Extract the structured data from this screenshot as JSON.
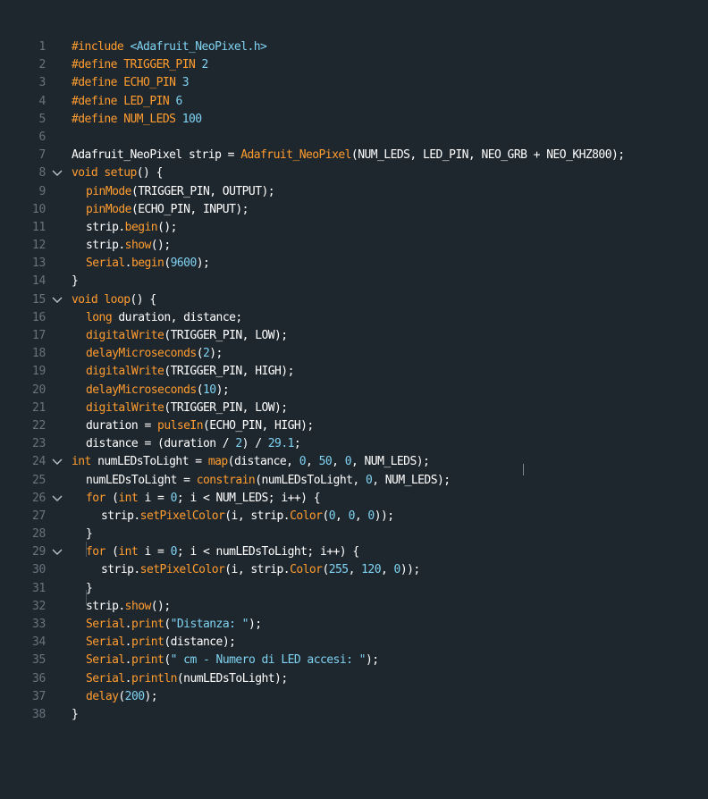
{
  "editor": {
    "colors": {
      "background": "#1f272e",
      "line_number": "#67737d",
      "keyword": "#ff9c2e",
      "number": "#7fd3f2",
      "text": "#ffffff"
    },
    "lines": [
      {
        "n": "1",
        "i": 0,
        "fold": false,
        "t": [
          {
            "c": "k",
            "v": "#include "
          },
          {
            "c": "s",
            "v": "<Adafruit_NeoPixel.h>"
          }
        ]
      },
      {
        "n": "2",
        "i": 0,
        "fold": false,
        "t": [
          {
            "c": "k",
            "v": "#define TRIGGER_PIN "
          },
          {
            "c": "num",
            "v": "2"
          }
        ]
      },
      {
        "n": "3",
        "i": 0,
        "fold": false,
        "t": [
          {
            "c": "k",
            "v": "#define ECHO_PIN "
          },
          {
            "c": "num",
            "v": "3"
          }
        ]
      },
      {
        "n": "4",
        "i": 0,
        "fold": false,
        "t": [
          {
            "c": "k",
            "v": "#define LED_PIN "
          },
          {
            "c": "num",
            "v": "6"
          }
        ]
      },
      {
        "n": "5",
        "i": 0,
        "fold": false,
        "t": [
          {
            "c": "k",
            "v": "#define NUM_LEDS "
          },
          {
            "c": "num",
            "v": "100"
          }
        ]
      },
      {
        "n": "6",
        "i": 0,
        "fold": false,
        "t": []
      },
      {
        "n": "7",
        "i": 0,
        "fold": false,
        "t": [
          {
            "c": "n",
            "v": "Adafruit_NeoPixel strip = "
          },
          {
            "c": "f",
            "v": "Adafruit_NeoPixel"
          },
          {
            "c": "n",
            "v": "(NUM_LEDS, LED_PIN, NEO_GRB + NEO_KHZ800);"
          }
        ]
      },
      {
        "n": "8",
        "i": 0,
        "fold": true,
        "t": [
          {
            "c": "k",
            "v": "void "
          },
          {
            "c": "f",
            "v": "setup"
          },
          {
            "c": "n",
            "v": "() {"
          }
        ]
      },
      {
        "n": "9",
        "i": 1,
        "fold": false,
        "t": [
          {
            "c": "f",
            "v": "pinMode"
          },
          {
            "c": "n",
            "v": "(TRIGGER_PIN, OUTPUT);"
          }
        ]
      },
      {
        "n": "10",
        "i": 1,
        "fold": false,
        "t": [
          {
            "c": "f",
            "v": "pinMode"
          },
          {
            "c": "n",
            "v": "(ECHO_PIN, INPUT);"
          }
        ]
      },
      {
        "n": "11",
        "i": 1,
        "fold": false,
        "t": [
          {
            "c": "n",
            "v": "strip."
          },
          {
            "c": "f",
            "v": "begin"
          },
          {
            "c": "n",
            "v": "();"
          }
        ]
      },
      {
        "n": "12",
        "i": 1,
        "fold": false,
        "t": [
          {
            "c": "n",
            "v": "strip."
          },
          {
            "c": "f",
            "v": "show"
          },
          {
            "c": "n",
            "v": "();"
          }
        ]
      },
      {
        "n": "13",
        "i": 1,
        "fold": false,
        "t": [
          {
            "c": "f",
            "v": "Serial"
          },
          {
            "c": "n",
            "v": "."
          },
          {
            "c": "f",
            "v": "begin"
          },
          {
            "c": "n",
            "v": "("
          },
          {
            "c": "num",
            "v": "9600"
          },
          {
            "c": "n",
            "v": ");"
          }
        ]
      },
      {
        "n": "14",
        "i": 0,
        "fold": false,
        "t": [
          {
            "c": "n",
            "v": "}"
          }
        ]
      },
      {
        "n": "15",
        "i": 0,
        "fold": true,
        "t": [
          {
            "c": "k",
            "v": "void "
          },
          {
            "c": "f",
            "v": "loop"
          },
          {
            "c": "n",
            "v": "() {"
          }
        ]
      },
      {
        "n": "16",
        "i": 1,
        "fold": false,
        "t": [
          {
            "c": "k",
            "v": "long "
          },
          {
            "c": "n",
            "v": "duration, distance;"
          }
        ]
      },
      {
        "n": "17",
        "i": 1,
        "fold": false,
        "t": [
          {
            "c": "f",
            "v": "digitalWrite"
          },
          {
            "c": "n",
            "v": "(TRIGGER_PIN, LOW);"
          }
        ]
      },
      {
        "n": "18",
        "i": 1,
        "fold": false,
        "t": [
          {
            "c": "f",
            "v": "delayMicroseconds"
          },
          {
            "c": "n",
            "v": "("
          },
          {
            "c": "num",
            "v": "2"
          },
          {
            "c": "n",
            "v": ");"
          }
        ]
      },
      {
        "n": "19",
        "i": 1,
        "fold": false,
        "t": [
          {
            "c": "f",
            "v": "digitalWrite"
          },
          {
            "c": "n",
            "v": "(TRIGGER_PIN, HIGH);"
          }
        ]
      },
      {
        "n": "20",
        "i": 1,
        "fold": false,
        "t": [
          {
            "c": "f",
            "v": "delayMicroseconds"
          },
          {
            "c": "n",
            "v": "("
          },
          {
            "c": "num",
            "v": "10"
          },
          {
            "c": "n",
            "v": ");"
          }
        ]
      },
      {
        "n": "21",
        "i": 1,
        "fold": false,
        "t": [
          {
            "c": "f",
            "v": "digitalWrite"
          },
          {
            "c": "n",
            "v": "(TRIGGER_PIN, LOW);"
          }
        ]
      },
      {
        "n": "22",
        "i": 1,
        "fold": false,
        "t": [
          {
            "c": "n",
            "v": "duration = "
          },
          {
            "c": "f",
            "v": "pulseIn"
          },
          {
            "c": "n",
            "v": "(ECHO_PIN, HIGH);"
          }
        ]
      },
      {
        "n": "23",
        "i": 1,
        "fold": false,
        "t": [
          {
            "c": "n",
            "v": "distance = (duration / "
          },
          {
            "c": "num",
            "v": "2"
          },
          {
            "c": "n",
            "v": ") / "
          },
          {
            "c": "num",
            "v": "29.1"
          },
          {
            "c": "n",
            "v": ";"
          }
        ]
      },
      {
        "n": "24",
        "i": 0,
        "fold": true,
        "t": [
          {
            "c": "k",
            "v": "int "
          },
          {
            "c": "n",
            "v": "numLEDsToLight = "
          },
          {
            "c": "f",
            "v": "map"
          },
          {
            "c": "n",
            "v": "(distance, "
          },
          {
            "c": "num",
            "v": "0"
          },
          {
            "c": "n",
            "v": ", "
          },
          {
            "c": "num",
            "v": "50"
          },
          {
            "c": "n",
            "v": ", "
          },
          {
            "c": "num",
            "v": "0"
          },
          {
            "c": "n",
            "v": ", NUM_LEDS);"
          }
        ]
      },
      {
        "n": "25",
        "i": 1,
        "fold": false,
        "t": [
          {
            "c": "n",
            "v": "numLEDsToLight = "
          },
          {
            "c": "f",
            "v": "constrain"
          },
          {
            "c": "n",
            "v": "(numLEDsToLight, "
          },
          {
            "c": "num",
            "v": "0"
          },
          {
            "c": "n",
            "v": ", NUM_LEDS);"
          }
        ]
      },
      {
        "n": "26",
        "i": 1,
        "fold": true,
        "t": [
          {
            "c": "k",
            "v": "for "
          },
          {
            "c": "n",
            "v": "("
          },
          {
            "c": "k",
            "v": "int "
          },
          {
            "c": "n",
            "v": "i = "
          },
          {
            "c": "num",
            "v": "0"
          },
          {
            "c": "n",
            "v": "; i < NUM_LEDS; i++) {"
          }
        ]
      },
      {
        "n": "27",
        "i": 2,
        "fold": false,
        "t": [
          {
            "c": "n",
            "v": "strip."
          },
          {
            "c": "f",
            "v": "setPixelColor"
          },
          {
            "c": "n",
            "v": "(i, strip."
          },
          {
            "c": "f",
            "v": "Color"
          },
          {
            "c": "n",
            "v": "("
          },
          {
            "c": "num",
            "v": "0"
          },
          {
            "c": "n",
            "v": ", "
          },
          {
            "c": "num",
            "v": "0"
          },
          {
            "c": "n",
            "v": ", "
          },
          {
            "c": "num",
            "v": "0"
          },
          {
            "c": "n",
            "v": "));"
          }
        ]
      },
      {
        "n": "28",
        "i": 1,
        "fold": false,
        "t": [
          {
            "c": "n",
            "v": "}"
          }
        ]
      },
      {
        "n": "29",
        "i": 1,
        "fold": true,
        "t": [
          {
            "c": "k",
            "v": "for "
          },
          {
            "c": "n",
            "v": "("
          },
          {
            "c": "k",
            "v": "int "
          },
          {
            "c": "n",
            "v": "i = "
          },
          {
            "c": "num",
            "v": "0"
          },
          {
            "c": "n",
            "v": "; i < numLEDsToLight; i++) {"
          }
        ]
      },
      {
        "n": "30",
        "i": 2,
        "fold": false,
        "t": [
          {
            "c": "n",
            "v": "strip."
          },
          {
            "c": "f",
            "v": "setPixelColor"
          },
          {
            "c": "n",
            "v": "(i, strip."
          },
          {
            "c": "f",
            "v": "Color"
          },
          {
            "c": "n",
            "v": "("
          },
          {
            "c": "num",
            "v": "255"
          },
          {
            "c": "n",
            "v": ", "
          },
          {
            "c": "num",
            "v": "120"
          },
          {
            "c": "n",
            "v": ", "
          },
          {
            "c": "num",
            "v": "0"
          },
          {
            "c": "n",
            "v": "));"
          }
        ]
      },
      {
        "n": "31",
        "i": 1,
        "fold": false,
        "t": [
          {
            "c": "n",
            "v": "}"
          }
        ]
      },
      {
        "n": "32",
        "i": 1,
        "fold": false,
        "t": [
          {
            "c": "n",
            "v": "strip."
          },
          {
            "c": "f",
            "v": "show"
          },
          {
            "c": "n",
            "v": "();"
          }
        ]
      },
      {
        "n": "33",
        "i": 1,
        "fold": false,
        "t": [
          {
            "c": "f",
            "v": "Serial"
          },
          {
            "c": "n",
            "v": "."
          },
          {
            "c": "f",
            "v": "print"
          },
          {
            "c": "n",
            "v": "("
          },
          {
            "c": "s",
            "v": "\"Distanza: \""
          },
          {
            "c": "n",
            "v": ");"
          }
        ]
      },
      {
        "n": "34",
        "i": 1,
        "fold": false,
        "t": [
          {
            "c": "f",
            "v": "Serial"
          },
          {
            "c": "n",
            "v": "."
          },
          {
            "c": "f",
            "v": "print"
          },
          {
            "c": "n",
            "v": "(distance);"
          }
        ]
      },
      {
        "n": "35",
        "i": 1,
        "fold": false,
        "t": [
          {
            "c": "f",
            "v": "Serial"
          },
          {
            "c": "n",
            "v": "."
          },
          {
            "c": "f",
            "v": "print"
          },
          {
            "c": "n",
            "v": "("
          },
          {
            "c": "s",
            "v": "\" cm - Numero di LED accesi: \""
          },
          {
            "c": "n",
            "v": ");"
          }
        ]
      },
      {
        "n": "36",
        "i": 1,
        "fold": false,
        "t": [
          {
            "c": "f",
            "v": "Serial"
          },
          {
            "c": "n",
            "v": "."
          },
          {
            "c": "f",
            "v": "println"
          },
          {
            "c": "n",
            "v": "(numLEDsToLight);"
          }
        ]
      },
      {
        "n": "37",
        "i": 1,
        "fold": false,
        "t": [
          {
            "c": "f",
            "v": "delay"
          },
          {
            "c": "n",
            "v": "("
          },
          {
            "c": "num",
            "v": "200"
          },
          {
            "c": "n",
            "v": ");"
          }
        ]
      },
      {
        "n": "38",
        "i": 0,
        "fold": false,
        "t": [
          {
            "c": "n",
            "v": "}"
          }
        ]
      }
    ]
  }
}
